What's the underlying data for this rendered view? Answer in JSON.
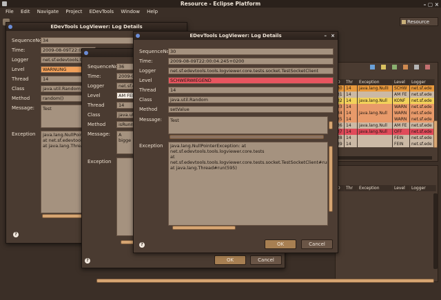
{
  "window": {
    "title": "Resource - Eclipse Platform"
  },
  "menu": [
    "File",
    "Edit",
    "Navigate",
    "Project",
    "EDevTools",
    "Window",
    "Help"
  ],
  "perspective": "Resource",
  "dialog_title": "EDevTools LogViewer: Log Details",
  "labels": {
    "seq": "SequenceNo:",
    "time": "Time:",
    "logger": "Logger",
    "level": "Level",
    "thread": "Thread",
    "class": "Class",
    "method": "Method",
    "message": "Message:",
    "exception": "Exception"
  },
  "buttons": {
    "ok": "OK",
    "cancel": "Cancel"
  },
  "dialog_back": {
    "seq": "34",
    "time": "2009-08-09T22:00:0",
    "logger": "net.sf.edevtools.to",
    "level": "WARNUNG",
    "thread": "14",
    "class": "java.util.Random",
    "method": "random()",
    "message": "Test",
    "exception_lines": [
      "java.lang.NullPointe",
      "  at net.sf.edevtools",
      "  at java.lang.Thread"
    ]
  },
  "dialog_mid": {
    "seq": "36",
    "time": "2009-08",
    "logger": "net.sf.e",
    "level": "AM FEI",
    "thread": "14",
    "class": "java.util",
    "method": "isRunni",
    "message": "A bigge"
  },
  "dialog_front": {
    "seq": "30",
    "time": "2009-08-09T22:00:04.245+0200",
    "logger": "net.sf.edevtools.tools.logviewer.core.tests.socket.TestSocketClient",
    "level": "SCHWERWIEGEND",
    "thread": "14",
    "class": "java.util.Random",
    "method": "setValue",
    "message": "Test",
    "exception_lines": [
      "java.lang.NullPointerException: at net.sf.edevtools.tools.logviewer.core.tests",
      "  at net.sf.edevtools.tools.logviewer.core.tests.socket.TestSocketClient#run(S",
      "  at java.lang.Thread#run(595)"
    ]
  },
  "log_table": {
    "headers": [
      "D",
      "Thr",
      "Exception",
      "Level",
      "Logger"
    ],
    "rows": [
      {
        "id": "30",
        "thr": "14",
        "exc": "java.lang.NullI",
        "level": "SCHW",
        "logger": "net.sf.ede",
        "bg": "#e8993c"
      },
      {
        "id": "31",
        "thr": "14",
        "exc": "",
        "level": "AM FE",
        "logger": "net.sf.ede",
        "bg": "#cbb9a5"
      },
      {
        "id": "32",
        "thr": "14",
        "exc": "java.lang.Null",
        "level": "KONF",
        "logger": "net.sf.ede",
        "bg": "#f2d25a"
      },
      {
        "id": "33",
        "thr": "14",
        "exc": "",
        "level": "WARN",
        "logger": "net.sf.ede",
        "bg": "#e89a6a"
      },
      {
        "id": "34",
        "thr": "14",
        "exc": "java.lang.Null",
        "level": "WARN",
        "logger": "net.sf.ede",
        "bg": "#e89a6a"
      },
      {
        "id": "35",
        "thr": "14",
        "exc": "",
        "level": "WARN",
        "logger": "net.sf.ede",
        "bg": "#e89a6a"
      },
      {
        "id": "36",
        "thr": "14",
        "exc": "java.lang.Null",
        "level": "AM FE",
        "logger": "net.sf.ede",
        "bg": "#cbb9a5"
      },
      {
        "id": "37",
        "thr": "14",
        "exc": "java.lang.Null",
        "level": "OFF",
        "logger": "net.sf.ede",
        "bg": "#e14a5a"
      },
      {
        "id": "38",
        "thr": "14",
        "exc": "",
        "level": "FEIN",
        "logger": "net.sf.ede",
        "bg": "#cbb9a5"
      },
      {
        "id": "39",
        "thr": "14",
        "exc": "",
        "level": "FEIN",
        "logger": "net.sf.ede",
        "bg": "#cbb9a5"
      }
    ]
  },
  "log_table2": {
    "headers": [
      "D",
      "Thr",
      "Exception",
      "Level",
      "Logger"
    ]
  }
}
